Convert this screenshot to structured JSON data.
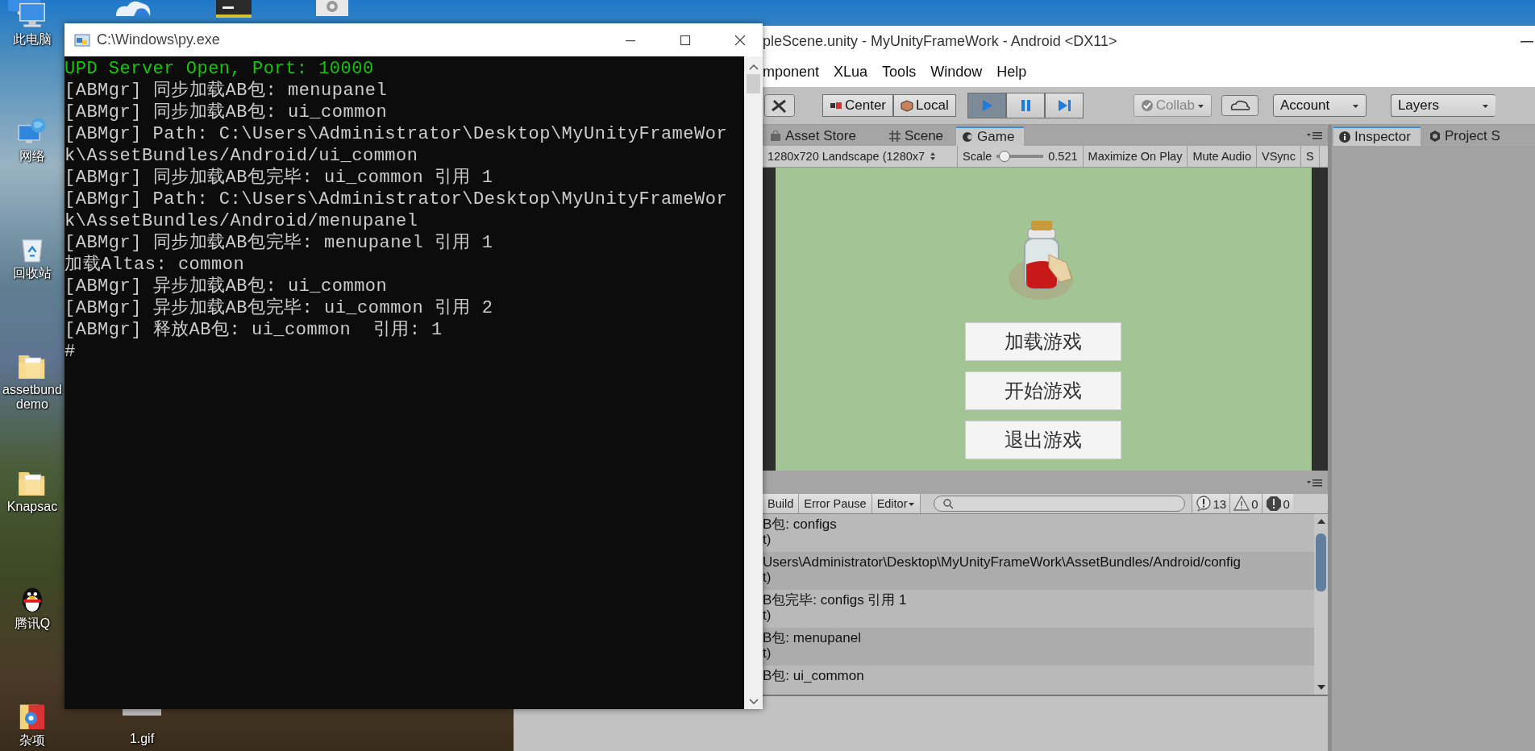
{
  "desktop": {
    "icons": [
      {
        "kind": "computer",
        "lines": [
          "此电脑"
        ]
      },
      {
        "kind": "network",
        "lines": [
          "网络"
        ]
      },
      {
        "kind": "recycle",
        "lines": [
          "回收站"
        ]
      },
      {
        "kind": "folder",
        "lines": [
          "assetbund",
          "demo"
        ]
      },
      {
        "kind": "folder",
        "lines": [
          "Knapsac"
        ]
      },
      {
        "kind": "penguin",
        "lines": [
          "腾讯Q"
        ]
      },
      {
        "kind": "app",
        "lines": [
          "杂项"
        ]
      }
    ],
    "bottom_icons": [
      {
        "kind": "file",
        "lines": [
          "1.gif"
        ]
      }
    ]
  },
  "console_window": {
    "title": "C:\\Windows\\py.exe",
    "lines": [
      {
        "kind": "success",
        "text": "UPD Server Open, Port: 10000"
      },
      {
        "kind": "normal",
        "text": "[ABMgr] 同步加载AB包: menupanel"
      },
      {
        "kind": "normal",
        "text": "[ABMgr] 同步加载AB包: ui_common"
      },
      {
        "kind": "normal",
        "text": "[ABMgr] Path: C:\\Users\\Administrator\\Desktop\\MyUnityFrameWor"
      },
      {
        "kind": "normal",
        "text": "k\\AssetBundles/Android/ui_common"
      },
      {
        "kind": "normal",
        "text": "[ABMgr] 同步加载AB包完毕: ui_common 引用 1"
      },
      {
        "kind": "normal",
        "text": "[ABMgr] Path: C:\\Users\\Administrator\\Desktop\\MyUnityFrameWor"
      },
      {
        "kind": "normal",
        "text": "k\\AssetBundles/Android/menupanel"
      },
      {
        "kind": "normal",
        "text": "[ABMgr] 同步加载AB包完毕: menupanel 引用 1"
      },
      {
        "kind": "normal",
        "text": "加载Altas: common"
      },
      {
        "kind": "normal",
        "text": "[ABMgr] 异步加载AB包: ui_common"
      },
      {
        "kind": "normal",
        "text": "[ABMgr] 异步加载AB包完毕: ui_common 引用 2"
      },
      {
        "kind": "normal",
        "text": "[ABMgr] 释放AB包: ui_common  引用: 1"
      },
      {
        "kind": "normal",
        "text": "#"
      }
    ]
  },
  "unity_window": {
    "title": "pleScene.unity - MyUnityFrameWork - Android <DX11>",
    "menu": [
      "mponent",
      "XLua",
      "Tools",
      "Window",
      "Help"
    ],
    "pivot_buttons": [
      "Center",
      "Local"
    ],
    "play_controls": [
      {
        "kind": "play",
        "on": true
      },
      {
        "kind": "pause",
        "on": false
      },
      {
        "kind": "step",
        "on": false
      }
    ],
    "collab": "Collab",
    "account": "Account",
    "layers": "Layers",
    "scene_tabs": [
      {
        "kind": "store",
        "label": "Asset Store",
        "selected": false
      },
      {
        "kind": "scene",
        "label": "Scene",
        "selected": false
      },
      {
        "kind": "game",
        "label": "Game",
        "selected": true
      }
    ],
    "side_tabs": [
      {
        "kind": "info",
        "label": "Inspector",
        "selected": true
      },
      {
        "kind": "project",
        "label": "Project S",
        "selected": false
      }
    ],
    "game_toolbar": {
      "resolution": "1280x720 Landscape (1280x7",
      "scale_label": "Scale",
      "scale": {
        "level": 0.04,
        "reading": "0.521"
      },
      "toggles": [
        "Maximize On Play",
        "Mute Audio",
        "VSync",
        "S"
      ]
    },
    "game_view": {
      "buttons": [
        "加载游戏",
        "开始游戏",
        "退出游戏"
      ]
    },
    "console": {
      "toolbar": [
        "Build",
        "Error Pause"
      ],
      "editor_dropdown": "Editor",
      "counts": [
        {
          "kind": "info",
          "count": "13"
        },
        {
          "kind": "warning",
          "count": "0"
        },
        {
          "kind": "error",
          "count": "0"
        }
      ],
      "rows": [
        {
          "lines": [
            "B包: configs",
            "t)"
          ]
        },
        {
          "lines": [
            "Users\\Administrator\\Desktop\\MyUnityFrameWork\\AssetBundles/Android/config",
            "t)"
          ]
        },
        {
          "lines": [
            "B包完毕: configs 引用 1",
            "t)"
          ]
        },
        {
          "lines": [
            "B包: menupanel",
            "t)"
          ]
        },
        {
          "lines": [
            "B包: ui_common"
          ]
        }
      ]
    }
  }
}
